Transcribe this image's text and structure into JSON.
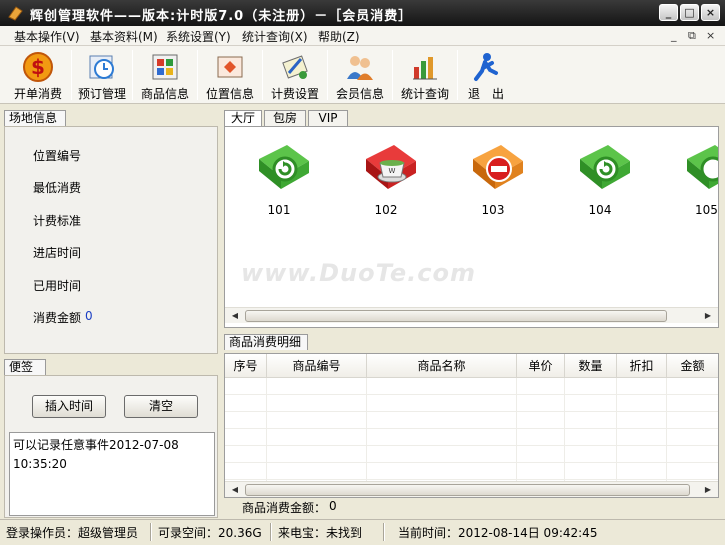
{
  "window": {
    "title": "辉创管理软件——版本:计时版7.0（未注册）－［会员消费］",
    "buttons": [
      "_",
      "□",
      "×"
    ]
  },
  "menu": {
    "items": [
      "基本操作(V)",
      "基本资料(M)",
      "系统设置(Y)",
      "统计查询(X)",
      "帮助(Z)"
    ],
    "mdi_controls": [
      "_",
      "⧉",
      "×"
    ]
  },
  "toolbar": {
    "items": [
      {
        "label": "开单消费",
        "icon": "money-icon"
      },
      {
        "label": "预订管理",
        "icon": "booking-icon"
      },
      {
        "label": "商品信息",
        "icon": "goods-icon"
      },
      {
        "label": "位置信息",
        "icon": "location-icon"
      },
      {
        "label": "计费设置",
        "icon": "billing-icon"
      },
      {
        "label": "会员信息",
        "icon": "members-icon"
      },
      {
        "label": "统计查询",
        "icon": "stats-icon"
      },
      {
        "label": "退　出",
        "icon": "exit-icon"
      }
    ]
  },
  "venue": {
    "tab": "场地信息",
    "fields": [
      {
        "label": "位置编号",
        "value": ""
      },
      {
        "label": "最低消费",
        "value": ""
      },
      {
        "label": "计费标准",
        "value": ""
      },
      {
        "label": "进店时间",
        "value": ""
      },
      {
        "label": "已用时间",
        "value": ""
      },
      {
        "label": "消费金额",
        "value": "0"
      }
    ]
  },
  "memo": {
    "tab": "便签",
    "insert_time": "插入时间",
    "clear": "清空",
    "text": "可以记录任意事件2012-07-08\n10:35:20"
  },
  "area_tabs": [
    "大厅",
    "包房",
    "VIP"
  ],
  "rooms": [
    {
      "number": "101",
      "status": "available",
      "color": "#3aa52d"
    },
    {
      "number": "102",
      "status": "occupied",
      "color": "#d42020"
    },
    {
      "number": "103",
      "status": "disabled",
      "color": "#f08a1e"
    },
    {
      "number": "104",
      "status": "available",
      "color": "#3aa52d"
    },
    {
      "number": "105",
      "status": "available",
      "color": "#3aa52d"
    }
  ],
  "detail": {
    "tab": "商品消费明细",
    "columns": [
      "序号",
      "商品编号",
      "商品名称",
      "单价",
      "数量",
      "折扣",
      "金额"
    ],
    "rows": [],
    "total_label": "商品消费金额：",
    "total_value": "0"
  },
  "watermark": "www.DuoTe.com",
  "status": {
    "operator": "登录操作员：超级管理员",
    "space": "可录空间：20.36G",
    "caller": "来电宝：未找到",
    "time": "当前时间：2012-08-14日  09:42:45"
  }
}
